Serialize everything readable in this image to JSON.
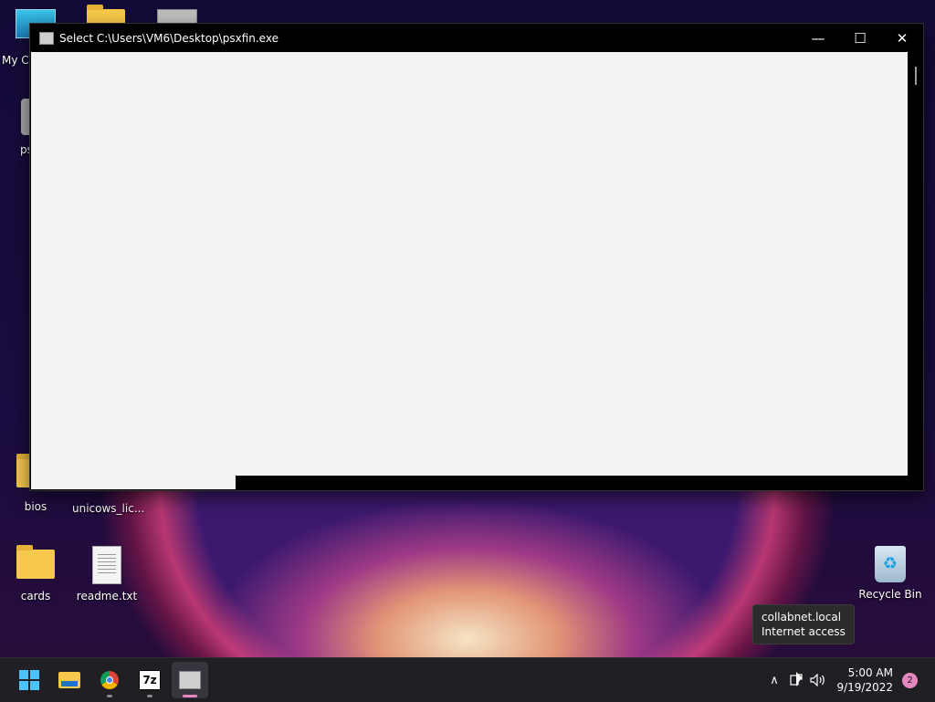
{
  "desktop": {
    "icons": [
      {
        "label": "My Co",
        "icon": "computer-icon"
      },
      {
        "label": "ps",
        "icon": "gear-icon"
      },
      {
        "label": "bios",
        "icon": "folder-icon"
      },
      {
        "label": "unicows_lic...",
        "icon": "document-icon"
      },
      {
        "label": "cards",
        "icon": "folder-icon"
      },
      {
        "label": "readme.txt",
        "icon": "text-file-icon"
      },
      {
        "label": "Recycle Bin",
        "icon": "recycle-bin-icon"
      }
    ]
  },
  "window": {
    "title": "Select C:\\Users\\VM6\\Desktop\\psxfin.exe",
    "controls": {
      "minimize": "—",
      "maximize": "☐",
      "close": "✕"
    }
  },
  "tooltip": {
    "line1": "collabnet.local",
    "line2": "Internet access"
  },
  "taskbar": {
    "apps": [
      {
        "name": "start",
        "icon": "windows-start-icon"
      },
      {
        "name": "file-explorer",
        "icon": "folder-icon"
      },
      {
        "name": "chrome",
        "icon": "chrome-icon"
      },
      {
        "name": "7-zip",
        "icon": "7zip-icon",
        "label": "7z"
      },
      {
        "name": "psxfin",
        "icon": "psx-app-icon"
      }
    ],
    "tray": {
      "chevron": "∧",
      "network": "network-icon",
      "volume": "volume-icon"
    },
    "time": "5:00 AM",
    "date": "9/19/2022",
    "notification_count": "2"
  },
  "colors": {
    "accent": "#4cc2ff",
    "active_indicator": "#e486c0",
    "taskbar_bg": "#1f1f24"
  }
}
